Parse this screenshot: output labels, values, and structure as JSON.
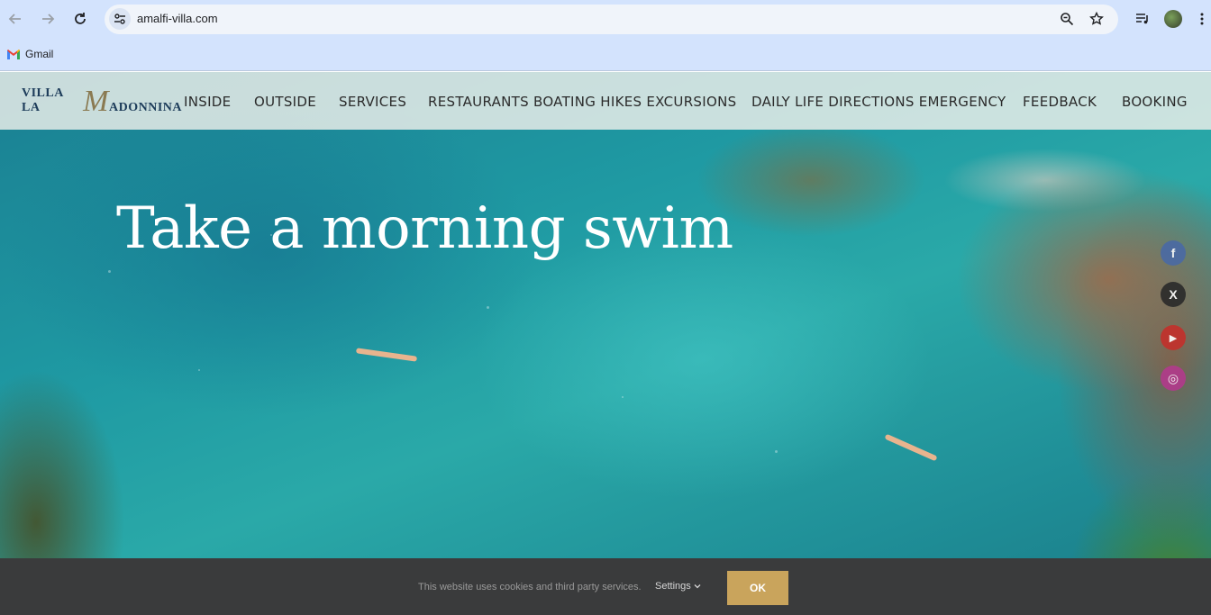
{
  "browser": {
    "url": "amalfi-villa.com",
    "bookmarks": [
      {
        "label": "Gmail"
      }
    ]
  },
  "site": {
    "logo": {
      "part1": "VILLA LA",
      "initial": "M",
      "part2": "ADONNINA"
    },
    "menu": [
      "INSIDE",
      "OUTSIDE",
      "SERVICES",
      "RESTAURANTS BOATING HIKES EXCURSIONS",
      "DAILY LIFE DIRECTIONS EMERGENCY",
      "FEEDBACK",
      "BOOKING"
    ],
    "hero_title": "Take a morning swim",
    "social": [
      {
        "icon": "facebook-icon",
        "glyph": "f",
        "color": "#4a6aa5"
      },
      {
        "icon": "x-icon",
        "glyph": "X",
        "color": "#2a2a2a"
      },
      {
        "icon": "youtube-icon",
        "glyph": "▶",
        "color": "#c4302b"
      },
      {
        "icon": "instagram-icon",
        "glyph": "◎",
        "color": "#b23a8c"
      }
    ]
  },
  "cookie_bar": {
    "text": "This website uses cookies and third party services.",
    "settings_label": "Settings",
    "ok_label": "OK"
  },
  "colors": {
    "accent": "#c9a45c",
    "chrome": "#d3e3fd",
    "cookie_bg": "#3a3b3c"
  }
}
